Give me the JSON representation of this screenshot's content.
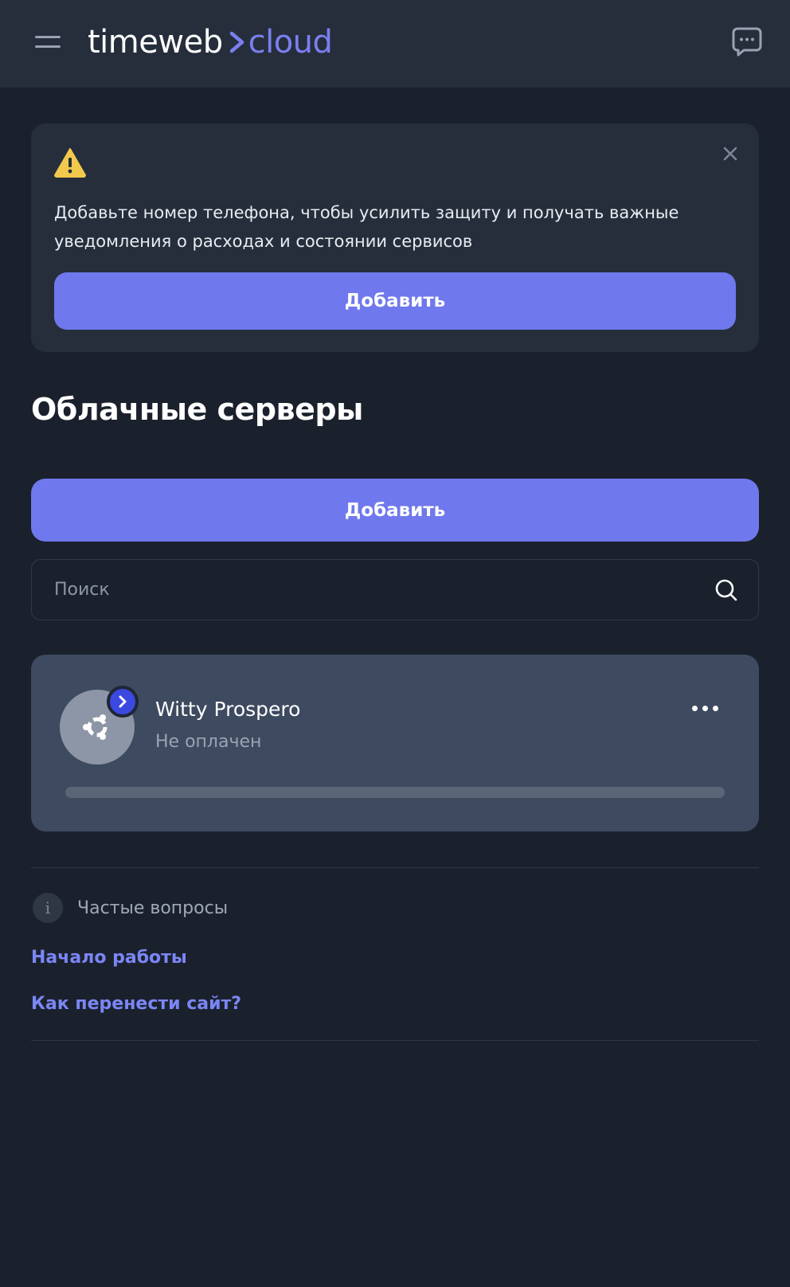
{
  "header": {
    "logo_part1": "timeweb",
    "logo_part2": "cloud"
  },
  "notice": {
    "text": "Добавьте номер телефона, чтобы усилить защиту и получать важные уведомления о расходах и состоянии сервисов",
    "button_label": "Добавить"
  },
  "page": {
    "title": "Облачные серверы",
    "add_button_label": "Добавить"
  },
  "search": {
    "placeholder": "Поиск",
    "value": ""
  },
  "servers": [
    {
      "name": "Witty Prospero",
      "status": "Не оплачен",
      "os_icon": "ubuntu-icon",
      "progress": 0
    }
  ],
  "faq": {
    "title": "Частые вопросы",
    "links": [
      "Начало работы",
      "Как перенести сайт?"
    ]
  },
  "colors": {
    "accent": "#6f78ec",
    "background": "#1b212c",
    "surface": "#262e3b",
    "card": "#3d4a5f",
    "link": "#7b86f5",
    "warning": "#f2c94c"
  }
}
